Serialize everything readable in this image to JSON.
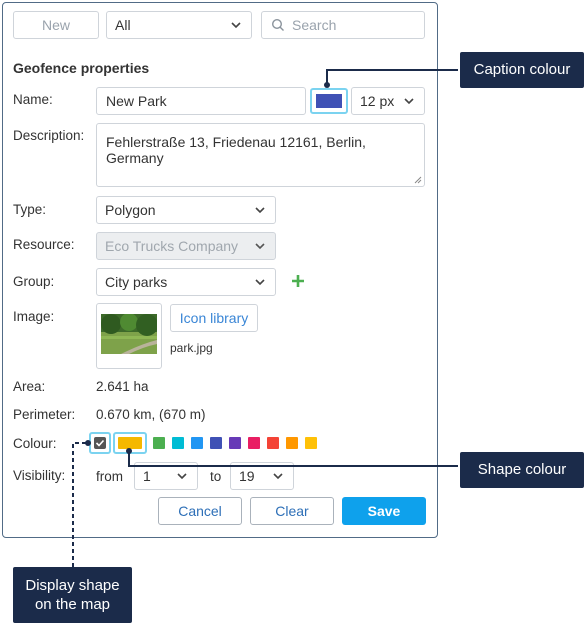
{
  "toolbar": {
    "new_label": "New",
    "filter_value": "All",
    "search_placeholder": "Search"
  },
  "section_title": "Geofence properties",
  "fields": {
    "name_label": "Name:",
    "name_value": "New Park",
    "caption_color": "#3f51b5",
    "font_size": "12 px",
    "description_label": "Description:",
    "description_value": "Fehlerstraße 13, Friedenau 12161, Berlin, Germany",
    "type_label": "Type:",
    "type_value": "Polygon",
    "resource_label": "Resource:",
    "resource_value": "Eco Trucks Company",
    "group_label": "Group:",
    "group_value": "City parks",
    "image_label": "Image:",
    "icon_library_label": "Icon library",
    "image_filename": "park.jpg",
    "area_label": "Area:",
    "area_value": "2.641 ha",
    "perimeter_label": "Perimeter:",
    "perimeter_value": "0.670 km, (670 m)",
    "colour_label": "Colour:",
    "shape_color": "#f5b800",
    "palette": [
      "#4caf50",
      "#00bcd4",
      "#2196f3",
      "#3f51b5",
      "#673ab7",
      "#e91e63",
      "#f44336",
      "#ff9800",
      "#ffc107"
    ],
    "visibility_label": "Visibility:",
    "from_label": "from",
    "from_value": "1",
    "to_label": "to",
    "to_value": "19"
  },
  "actions": {
    "cancel_label": "Cancel",
    "clear_label": "Clear",
    "save_label": "Save"
  },
  "callouts": {
    "caption_colour": "Caption colour",
    "shape_colour": "Shape colour",
    "display_shape": "Display shape on the map"
  }
}
